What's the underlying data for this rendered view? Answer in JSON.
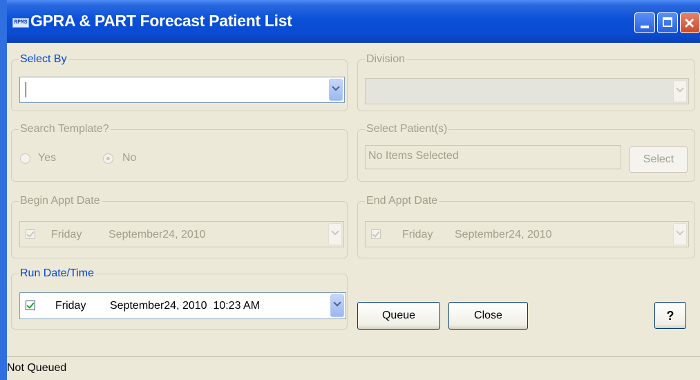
{
  "window": {
    "title": "GPRA & PART Forecast Patient List",
    "icon_text": "RPMS",
    "title_buttons": {
      "minimize": "minimize",
      "maximize": "maximize",
      "close": "×"
    }
  },
  "select_by": {
    "label": "Select By",
    "value": "",
    "enabled": true
  },
  "division": {
    "label": "Division",
    "value": "",
    "enabled": false
  },
  "search_template": {
    "label": "Search Template?",
    "options": [
      {
        "label": "Yes",
        "checked": false
      },
      {
        "label": "No",
        "checked": true
      }
    ],
    "enabled": false
  },
  "select_patients": {
    "label": "Select Patient(s)",
    "value": "No Items Selected",
    "button_label": "Select",
    "enabled": false
  },
  "begin_appt_date": {
    "label": "Begin Appt Date",
    "checked": true,
    "day": "Friday",
    "date": "September24, 2010",
    "enabled": false
  },
  "end_appt_date": {
    "label": "End Appt Date",
    "checked": true,
    "day": "Friday",
    "date": "September24, 2010",
    "enabled": false
  },
  "run_date_time": {
    "label": "Run Date/Time",
    "checked": true,
    "day": "Friday",
    "date": "September24, 2010  10:23 AM",
    "enabled": true
  },
  "buttons": {
    "queue": "Queue",
    "close": "Close",
    "help": "?"
  },
  "status": {
    "text": "Not Queued"
  },
  "colors": {
    "title_bar": "#0a50d8",
    "dialog_bg": "#ece9d8",
    "group_label": "#0046d5",
    "disabled_text": "#a0a08a"
  }
}
